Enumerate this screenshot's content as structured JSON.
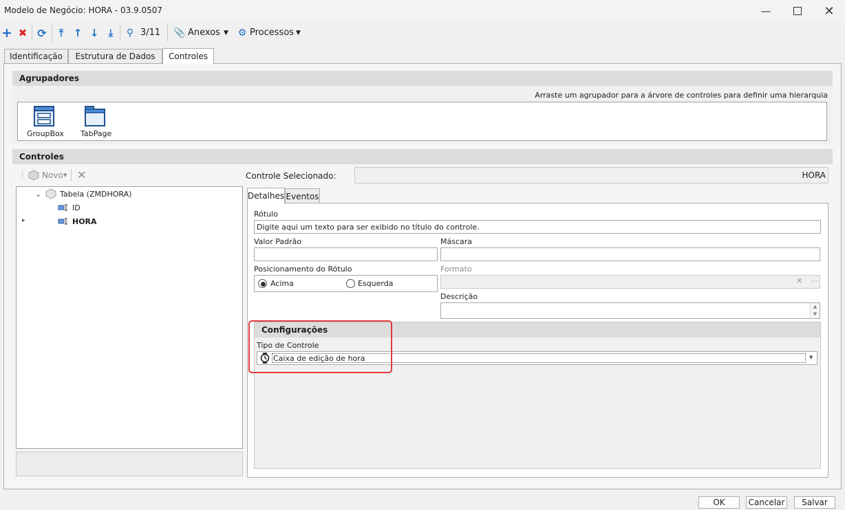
{
  "window": {
    "title": "Modelo de Negócio: HORA - 03.9.0507"
  },
  "toolbar": {
    "record_counter": "3/11",
    "anexos_label": "Anexos",
    "processos_label": "Processos"
  },
  "tabs": [
    "Identificação",
    "Estrutura de Dados",
    "Controles"
  ],
  "agrupadores": {
    "header": "Agrupadores",
    "hint": "Arraste um agrupador para a árvore de controles para definir uma hierarquia",
    "items": [
      {
        "label": "GroupBox"
      },
      {
        "label": "TabPage"
      }
    ]
  },
  "controles": {
    "header": "Controles",
    "novo_label": "Novo",
    "tree": {
      "root": "Tabela (ZMDHORA)",
      "children": [
        "ID",
        "HORA"
      ]
    },
    "selected_label": "Controle Selecionado:",
    "selected_value": "HORA",
    "detail_tabs": [
      "Detalhes",
      "Eventos"
    ]
  },
  "detalhes": {
    "rotulo_label": "Rótulo",
    "rotulo_value": "Digite aqui um texto para ser exibido no título do controle.",
    "valor_padrao_label": "Valor Padrão",
    "mascara_label": "Máscara",
    "posicionamento_label": "Posicionamento do Rótulo",
    "radio_acima": "Acima",
    "radio_esquerda": "Esquerda",
    "formato_label": "Formato",
    "descricao_label": "Descrição",
    "config_header": "Configurações",
    "tipo_label": "Tipo de Controle",
    "tipo_value": "Caixa de edição de hora"
  },
  "footer": {
    "ok": "OK",
    "cancel": "Cancelar",
    "save": "Salvar"
  },
  "colors": {
    "add": "#1e6fc8",
    "delete": "#d9262b",
    "highlight": "#e03a3a"
  }
}
